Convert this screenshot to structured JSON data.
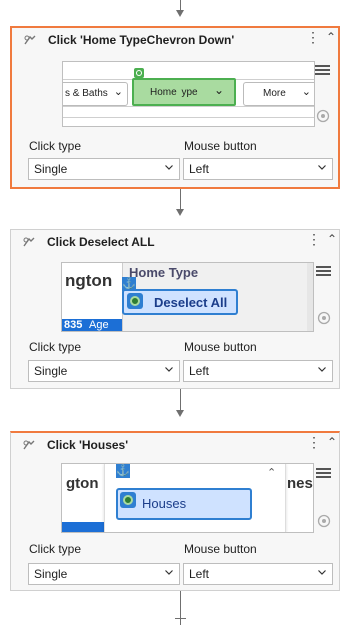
{
  "cards": [
    {
      "title": "Click 'Home TypeChevron Down'",
      "click_type_label": "Click type",
      "mouse_button_label": "Mouse button",
      "click_type_value": "Single",
      "mouse_button_value": "Left",
      "preview": {
        "left_text": "s & Baths",
        "selected_text": "Home  ype",
        "right_text": "More"
      }
    },
    {
      "title": "Click Deselect ALL",
      "click_type_label": "Click type",
      "mouse_button_label": "Mouse button",
      "click_type_value": "Single",
      "mouse_button_value": "Left",
      "preview": {
        "bg_text": "ngton",
        "popup_title": "Home Type",
        "button_text": "Deselect All",
        "bottom_number": "835",
        "bottom_text": "Age"
      }
    },
    {
      "title": "Click 'Houses'",
      "click_type_label": "Click type",
      "mouse_button_label": "Mouse button",
      "click_type_value": "Single",
      "mouse_button_value": "Left",
      "preview": {
        "bg_left": "gton",
        "bg_right": "nes",
        "item_text": "Houses"
      }
    }
  ],
  "colors": {
    "selected_border": "#f07a3e",
    "highlight_green": "#a9dba0",
    "highlight_blue": "#cfe2ff",
    "anchor_blue": "#2f7fd1"
  }
}
